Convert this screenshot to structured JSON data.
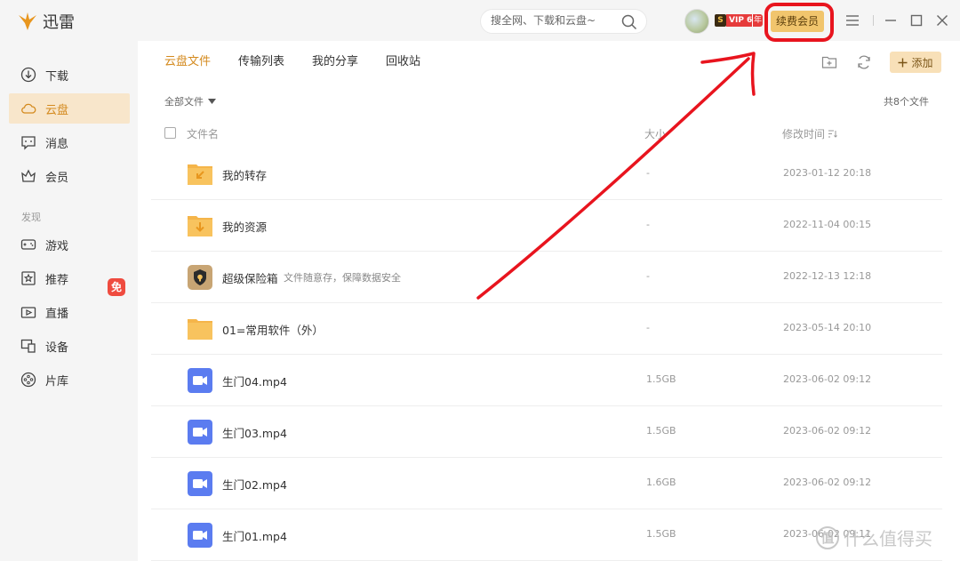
{
  "app": {
    "title": "迅雷"
  },
  "search": {
    "placeholder": "搜全网、下载和云盘~"
  },
  "user": {
    "badge_s": "S",
    "badge_vip": "VIP 6",
    "badge_year": "年",
    "renew_label": "续费会员"
  },
  "sidebar": {
    "items": [
      {
        "label": "下载",
        "icon": "download-icon"
      },
      {
        "label": "云盘",
        "icon": "cloud-icon",
        "active": true
      },
      {
        "label": "消息",
        "icon": "message-icon"
      },
      {
        "label": "会员",
        "icon": "crown-icon"
      }
    ],
    "section_label": "发现",
    "discover": [
      {
        "label": "游戏",
        "icon": "gamepad-icon",
        "badge": "免"
      },
      {
        "label": "推荐",
        "icon": "star-icon"
      },
      {
        "label": "直播",
        "icon": "live-icon"
      },
      {
        "label": "设备",
        "icon": "device-icon"
      },
      {
        "label": "片库",
        "icon": "film-icon"
      }
    ]
  },
  "tabs": [
    "云盘文件",
    "传输列表",
    "我的分享",
    "回收站"
  ],
  "toolbar": {
    "add_label": "添加"
  },
  "filter": {
    "label": "全部文件"
  },
  "file_count": "共8个文件",
  "columns": {
    "name": "文件名",
    "size": "大小",
    "modified": "修改时间"
  },
  "files": [
    {
      "name": "我的转存",
      "desc": "",
      "size": "-",
      "modified": "2023-01-12 20:18",
      "type": "folder-transfer"
    },
    {
      "name": "我的资源",
      "desc": "",
      "size": "-",
      "modified": "2022-11-04 00:15",
      "type": "folder-resource"
    },
    {
      "name": "超级保险箱",
      "desc": "文件随意存，保障数据安全",
      "size": "-",
      "modified": "2022-12-13 12:18",
      "type": "safe"
    },
    {
      "name": "01=常用软件（外）",
      "desc": "",
      "size": "-",
      "modified": "2023-05-14 20:10",
      "type": "folder"
    },
    {
      "name": "生门04.mp4",
      "desc": "",
      "size": "1.5GB",
      "modified": "2023-06-02 09:12",
      "type": "video"
    },
    {
      "name": "生门03.mp4",
      "desc": "",
      "size": "1.5GB",
      "modified": "2023-06-02 09:12",
      "type": "video"
    },
    {
      "name": "生门02.mp4",
      "desc": "",
      "size": "1.6GB",
      "modified": "2023-06-02 09:12",
      "type": "video"
    },
    {
      "name": "生门01.mp4",
      "desc": "",
      "size": "1.5GB",
      "modified": "2023-06-02 09:11",
      "type": "video"
    }
  ],
  "watermark": {
    "logo": "值",
    "text": "什么值得买"
  },
  "colors": {
    "accent": "#d48a1e",
    "highlight": "#e8141e",
    "folder": "#f5b54a",
    "video": "#5b7cf0"
  }
}
